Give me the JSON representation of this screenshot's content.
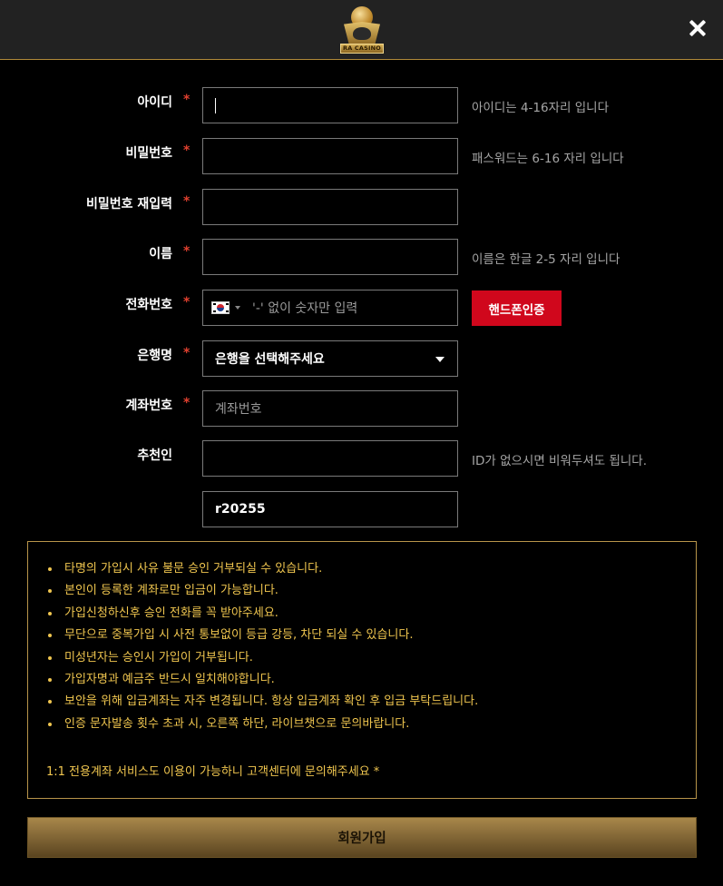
{
  "header": {
    "logo_text": "RA CASINO",
    "close_icon": "close-icon"
  },
  "form": {
    "username": {
      "label": "아이디",
      "required_mark": "*",
      "value": "",
      "hint": "아이디는 4-16자리 입니다"
    },
    "password": {
      "label": "비밀번호",
      "required_mark": "*",
      "value": "",
      "hint": "패스워드는 6-16 자리 입니다"
    },
    "password_confirm": {
      "label": "비밀번호 재입력",
      "required_mark": "*",
      "value": ""
    },
    "name": {
      "label": "이름",
      "required_mark": "*",
      "value": "",
      "hint": "이름은 한글 2-5 자리 입니다"
    },
    "phone": {
      "label": "전화번호",
      "required_mark": "*",
      "country": "KR",
      "placeholder": "'-' 없이 숫자만 입력",
      "verify_button": "핸드폰인증"
    },
    "bank": {
      "label": "은행명",
      "required_mark": "*",
      "selected": "은행을 선택해주세요"
    },
    "account": {
      "label": "계좌번호",
      "required_mark": "*",
      "placeholder": "계좌번호"
    },
    "referrer": {
      "label": "추천인",
      "value": "",
      "hint": "ID가 없으시면 비워두셔도 됩니다."
    },
    "code": {
      "value": "r20255"
    }
  },
  "notice": {
    "items": [
      "타명의 가입시 사유 불문 승인 거부되실 수 있습니다.",
      "본인이 등록한 계좌로만 입금이 가능합니다.",
      "가입신청하신후 승인 전화를 꼭 받아주세요.",
      "무단으로 중복가입 시 사전 통보없이 등급 강등, 차단 되실 수 있습니다.",
      "미성년자는 승인시 가입이 거부됩니다.",
      "가입자명과 예금주 반드시 일치해야합니다.",
      "보안을 위해 입금계좌는 자주 변경됩니다. 항상 입금계좌 확인 후 입금 부탁드립니다.",
      "인증 문자발송 횟수 초과 시, 오른쪽 하단, 라이브챗으로 문의바랍니다."
    ],
    "footnote": "1:1 전용계좌 서비스도 이용이 가능하니 고객센터에 문의해주세요 *"
  },
  "submit_label": "회원가입",
  "colors": {
    "background": "#000000",
    "header": "#222222",
    "required": "#e0402f",
    "notice_text": "#f0c64f",
    "verify_button": "#d0071c",
    "submit_gold": "#a8874a"
  }
}
